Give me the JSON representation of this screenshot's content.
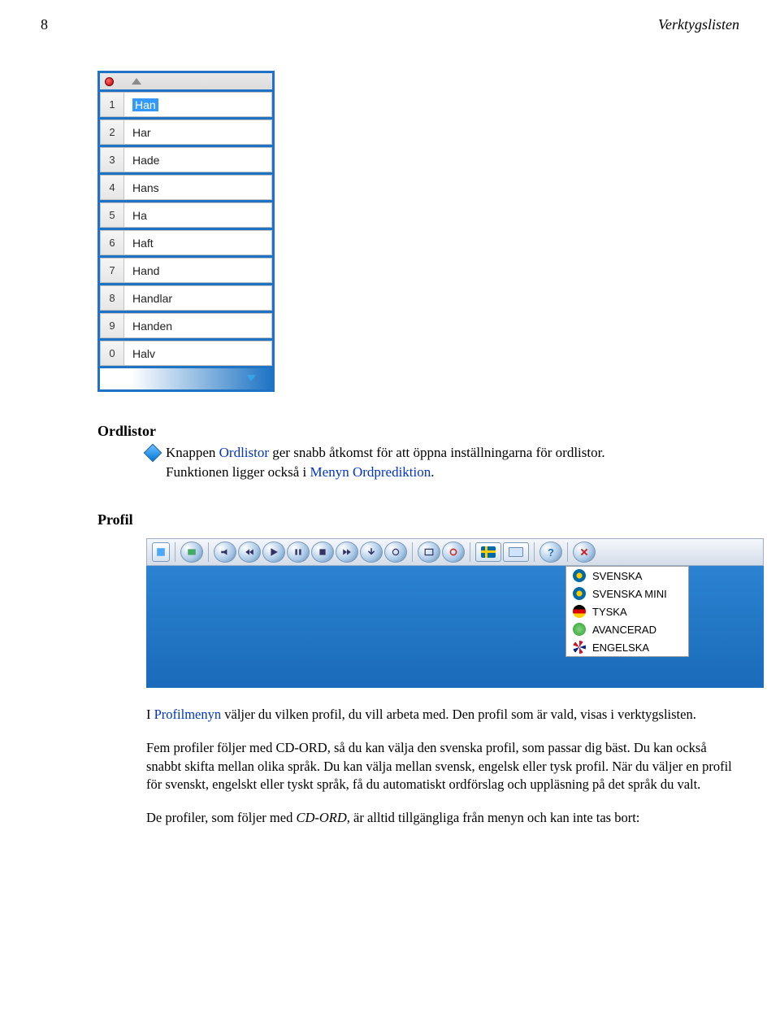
{
  "page_header": {
    "number": "8",
    "title": "Verktygslisten"
  },
  "prediction_panel": {
    "rows": [
      {
        "num": "1",
        "word": "Han",
        "selected": true
      },
      {
        "num": "2",
        "word": "Har",
        "selected": false
      },
      {
        "num": "3",
        "word": "Hade",
        "selected": false
      },
      {
        "num": "4",
        "word": "Hans",
        "selected": false
      },
      {
        "num": "5",
        "word": "Ha",
        "selected": false
      },
      {
        "num": "6",
        "word": "Haft",
        "selected": false
      },
      {
        "num": "7",
        "word": "Hand",
        "selected": false
      },
      {
        "num": "8",
        "word": "Handlar",
        "selected": false
      },
      {
        "num": "9",
        "word": "Handen",
        "selected": false
      },
      {
        "num": "0",
        "word": "Halv",
        "selected": false
      }
    ]
  },
  "section_ordlistor": {
    "heading": "Ordlistor",
    "line_pre": "Knappen ",
    "line_link": "Ordlistor",
    "line_mid": " ger snabb åtkomst för att öppna inställningarna för ordlistor.",
    "line2_pre": "Funktionen ligger också i ",
    "line2_link": "Menyn Ordprediktion",
    "line2_post": "."
  },
  "section_profil": {
    "heading": "Profil"
  },
  "profile_menu": {
    "items": [
      {
        "label": "SVENSKA",
        "icon": "se"
      },
      {
        "label": "SVENSKA MINI",
        "icon": "se"
      },
      {
        "label": "TYSKA",
        "icon": "de"
      },
      {
        "label": "AVANCERAD",
        "icon": "green"
      },
      {
        "label": "ENGELSKA",
        "icon": "uk"
      }
    ]
  },
  "body_text": {
    "p1a": "I ",
    "p1_link": "Profilmenyn",
    "p1b": " väljer du vilken profil, du vill arbeta med. Den profil som är vald, visas i verktygslisten.",
    "p2": "Fem profiler följer med CD-ORD, så du kan välja den svenska profil, som passar dig bäst. Du kan också snabbt skifta mellan olika språk. Du kan välja mellan svensk, engelsk eller tysk profil. När du väljer en profil för svenskt, engelskt eller tyskt språk, få du automatiskt ordförslag och uppläsning på det språk du valt.",
    "p3a": "De profiler, som följer med ",
    "p3_em": "CD-ORD",
    "p3b": ", är alltid tillgängliga från menyn och kan inte tas bort:"
  }
}
